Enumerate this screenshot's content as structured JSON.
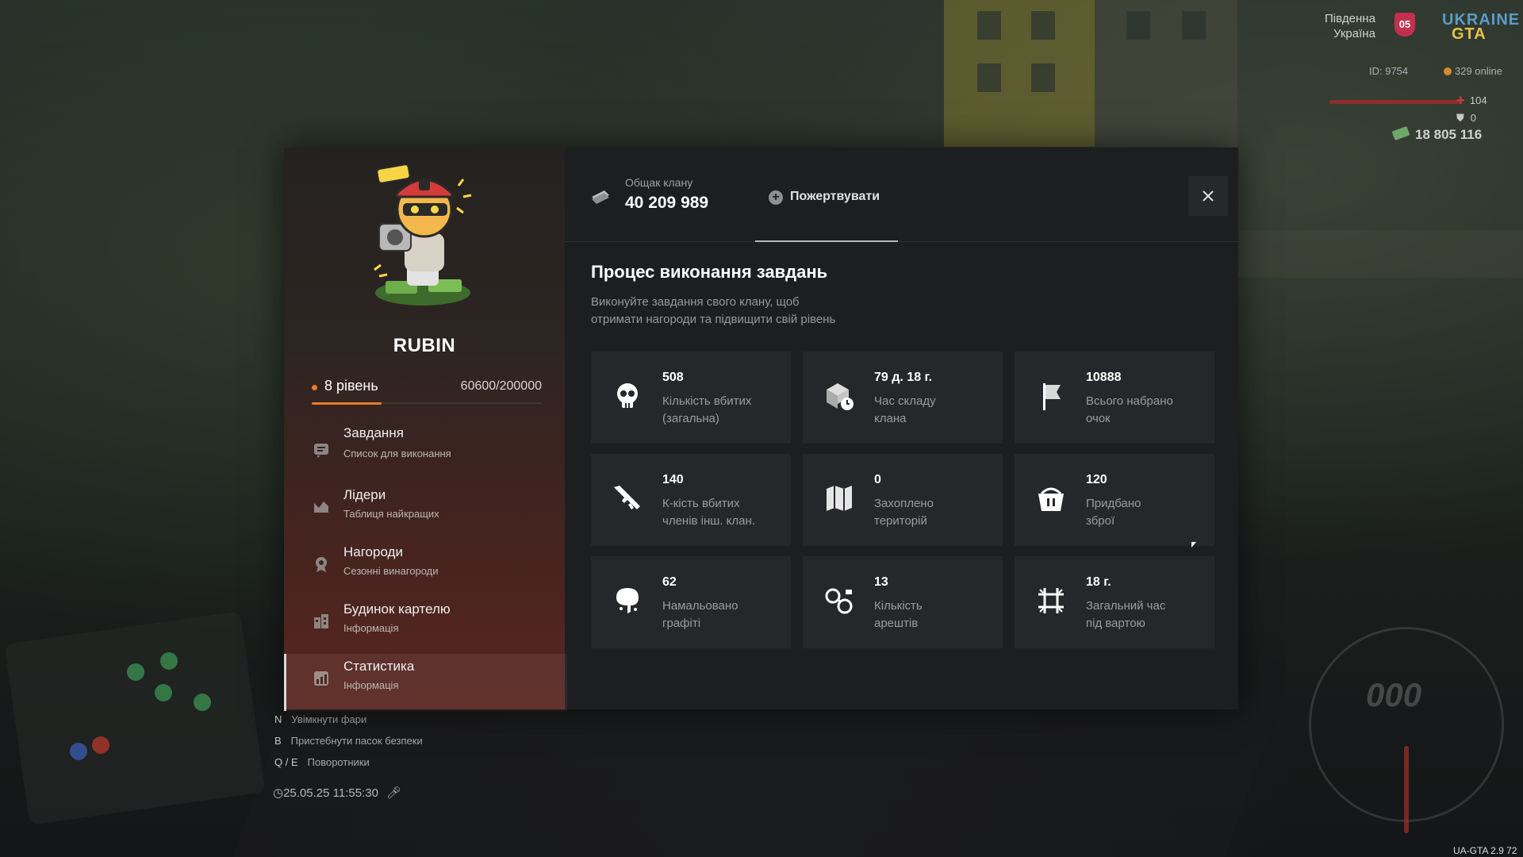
{
  "hud": {
    "region_line1": "Південна",
    "region_line2": "Україна",
    "region_badge": "05",
    "logo_line1": "UKRAINE",
    "logo_line2": "GTA",
    "player_id": "ID: 9754",
    "online": "329 online",
    "health": "104",
    "armor": "0",
    "money": "18 805 116",
    "hint1_key": "N",
    "hint1_text": "Увімкнути фари",
    "hint2_key": "B",
    "hint2_text": "Пристебнути пасок безпеки",
    "hint3_key": "Q / E",
    "hint3_text": "Поворотники",
    "datetime": "25.05.25 11:55:30",
    "speed": "000",
    "version": "UA-GTA 2.9   72"
  },
  "clan": {
    "name": "RUBIN",
    "level_label": "8 рівень",
    "xp": "60600/200000",
    "xp_fraction": 0.303
  },
  "menu": [
    {
      "title": "Завдання",
      "sub": "Список для виконання",
      "icon": "tasks-icon"
    },
    {
      "title": "Лідери",
      "sub": "Таблиця найкращих",
      "icon": "leaders-icon"
    },
    {
      "title": "Нагороди",
      "sub": "Сезонні винагороди",
      "icon": "rewards-icon"
    },
    {
      "title": "Будинок картелю",
      "sub": "Інформація",
      "icon": "house-icon"
    },
    {
      "title": "Статистика",
      "sub": "Інформація",
      "icon": "statistics-icon"
    }
  ],
  "topbar": {
    "bank_label": "Общак клану",
    "bank_value": "40 209 989",
    "donate_label": "Пожертвувати"
  },
  "section": {
    "title": "Процес виконання завдань",
    "desc_line1": "Виконуйте завдання свого клану, щоб",
    "desc_line2": "отримати нагороди та підвищити свій рівень"
  },
  "stats": [
    {
      "value": "508",
      "label1": "Кількість вбитих",
      "label2": "(загальна)",
      "icon": "skull-icon"
    },
    {
      "value": "79 д. 18 г.",
      "label1": "Час складу",
      "label2": "клана",
      "icon": "warehouse-icon"
    },
    {
      "value": "10888",
      "label1": "Всього набрано",
      "label2": "очок",
      "icon": "flag-icon"
    },
    {
      "value": "140",
      "label1": "К-кість вбитих",
      "label2": "членів інш. клан.",
      "icon": "rifle-icon"
    },
    {
      "value": "0",
      "label1": "Захоплено",
      "label2": "територій",
      "icon": "map-icon"
    },
    {
      "value": "120",
      "label1": "Придбано",
      "label2": "зброї",
      "icon": "basket-icon"
    },
    {
      "value": "62",
      "label1": "Намальовано",
      "label2": "графіті",
      "icon": "spray-icon"
    },
    {
      "value": "13",
      "label1": "Кількість",
      "label2": "арештів",
      "icon": "handcuffs-icon"
    },
    {
      "value": "18 г.",
      "label1": "Загальний час",
      "label2": "під вартою",
      "icon": "prison-icon"
    }
  ]
}
